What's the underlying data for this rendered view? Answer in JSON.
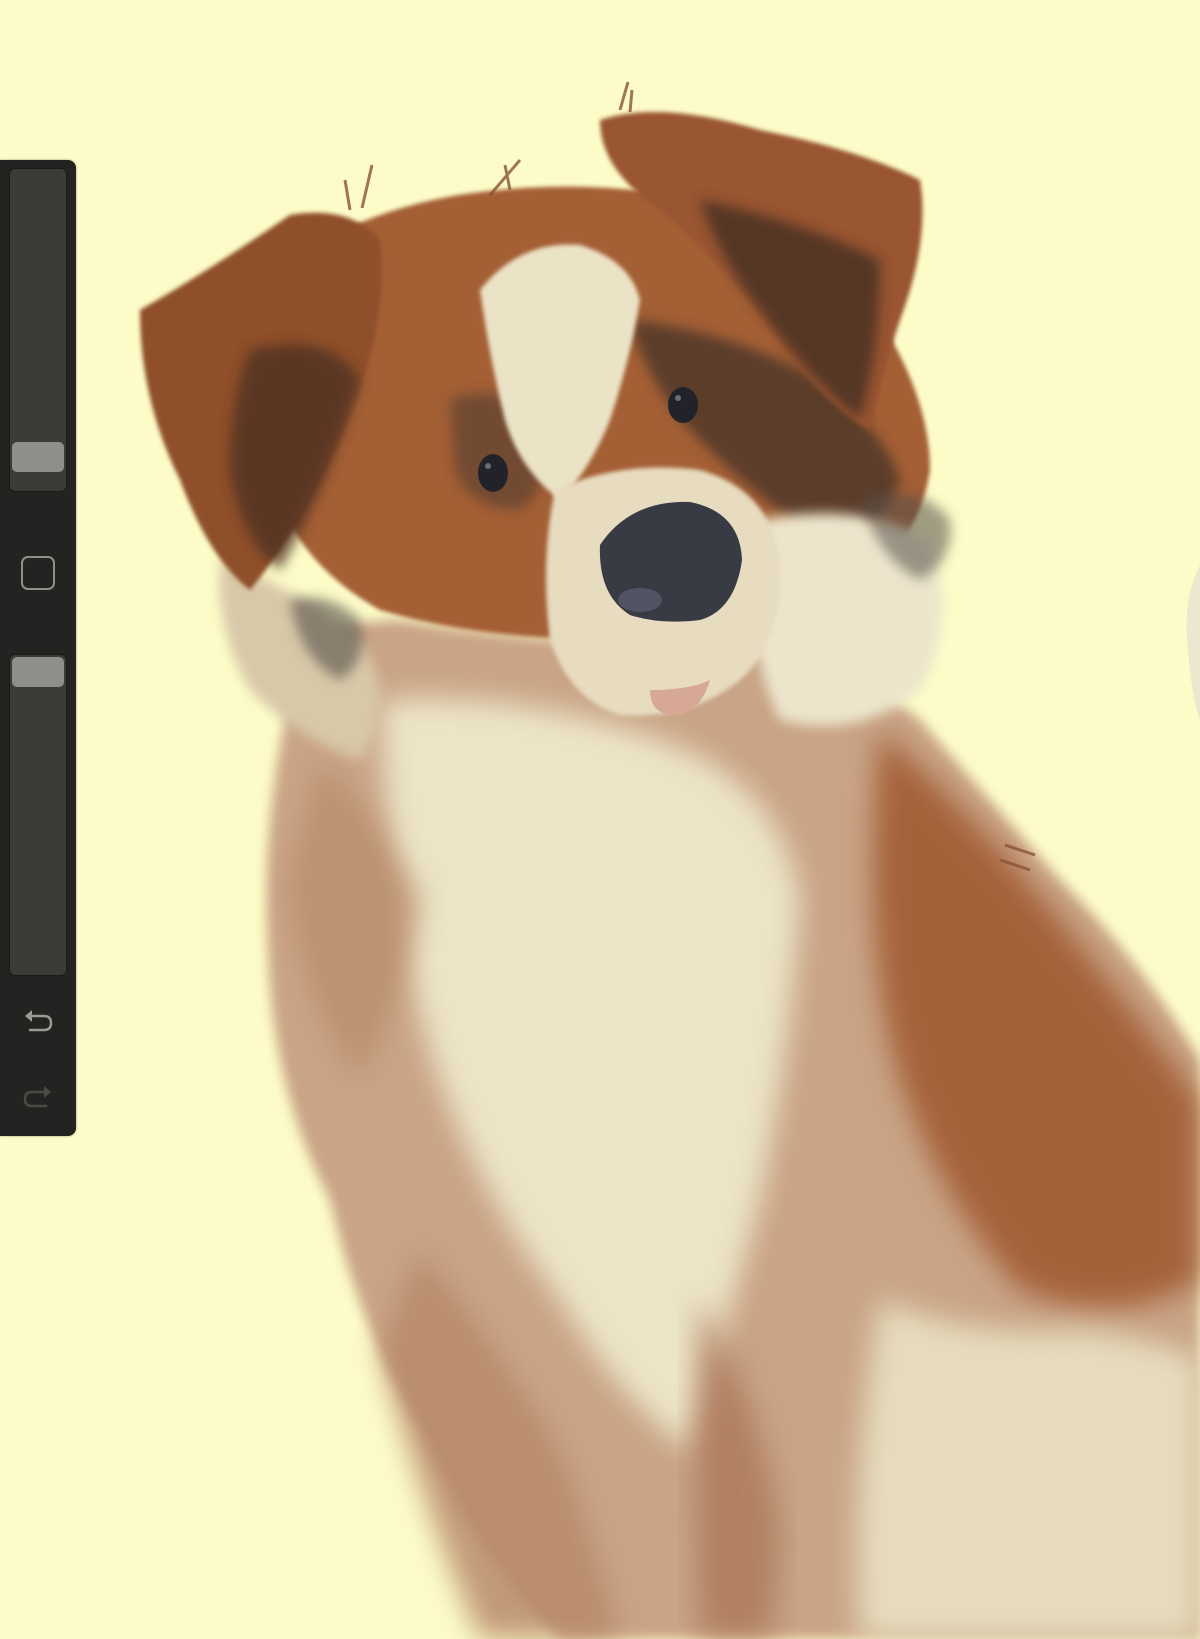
{
  "app": {
    "canvas_background": "#fdfcc8",
    "artwork": "dog-illustration"
  },
  "colors": {
    "fur_brown": "#a05f38",
    "fur_dark": "#5a3a28",
    "fur_cream": "#eae3c6",
    "fur_tan": "#c39b7a",
    "nose": "#383a44",
    "toolbar_bg": "#232321",
    "slider_track": "#3b3b37",
    "slider_thumb": "#8e8e8b"
  },
  "sidebar": {
    "brush_size": {
      "icon": "brush-size-slider",
      "level": 0.06
    },
    "modify": {
      "icon": "square-icon"
    },
    "opacity": {
      "icon": "opacity-slider",
      "level": 1.0
    },
    "undo": {
      "icon": "undo-icon",
      "enabled": true
    },
    "redo": {
      "icon": "redo-icon",
      "enabled": false
    }
  }
}
